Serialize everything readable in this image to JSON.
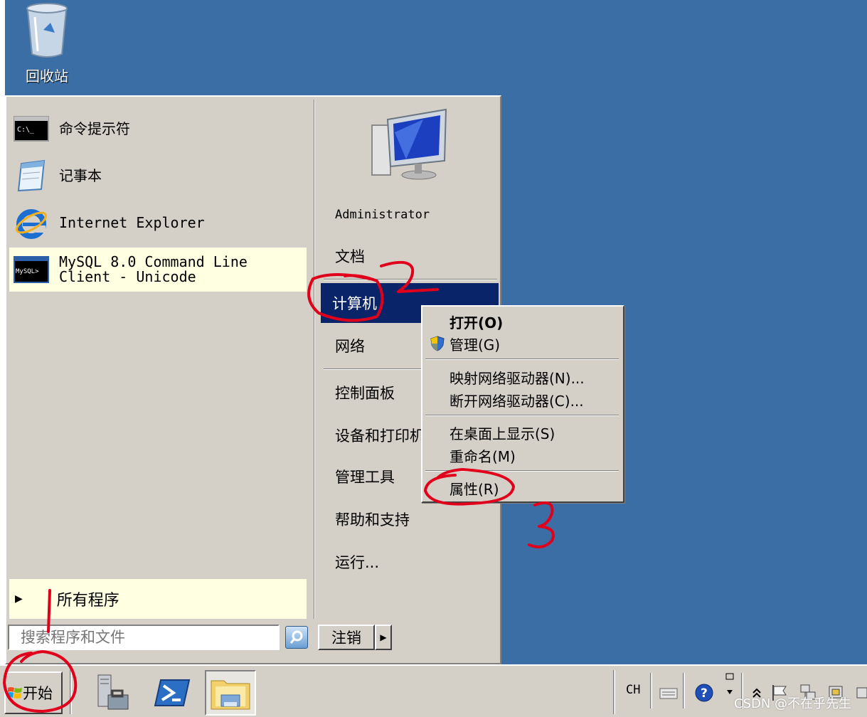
{
  "desktop": {
    "recycle_bin_label": "回收站"
  },
  "start_menu": {
    "pinned_programs": [
      {
        "label": "命令提示符",
        "icon": "cmd-icon"
      },
      {
        "label": "记事本",
        "icon": "notepad-icon"
      },
      {
        "label": "Internet Explorer",
        "icon": "ie-icon"
      },
      {
        "label_line1": "MySQL 8.0 Command Line",
        "label_line2": "Client - Unicode",
        "icon": "mysql-icon"
      }
    ],
    "all_programs_label": "所有程序",
    "search_placeholder": "搜索程序和文件",
    "right_items": {
      "user": "Administrator",
      "documents": "文档",
      "computer": "计算机",
      "network": "网络",
      "control_panel": "控制面板",
      "devices_printers": "设备和打印机",
      "admin_tools": "管理工具",
      "help": "帮助和支持",
      "run": "运行..."
    },
    "logoff_label": "注销"
  },
  "context_menu": {
    "open": "打开(O)",
    "manage": "管理(G)",
    "map_drive": "映射网络驱动器(N)...",
    "disconnect_drive": "断开网络驱动器(C)...",
    "show_on_desktop": "在桌面上显示(S)",
    "rename": "重命名(M)",
    "properties": "属性(R)"
  },
  "taskbar": {
    "start_label": "开始",
    "tray_language": "CH"
  },
  "annotations": {
    "step2": "2",
    "step3": "3"
  },
  "watermark": "CSDN @不在乎先生",
  "colors": {
    "desktop": "#3a6ea5",
    "selection": "#0a246a",
    "annotation": "#e0001b"
  }
}
